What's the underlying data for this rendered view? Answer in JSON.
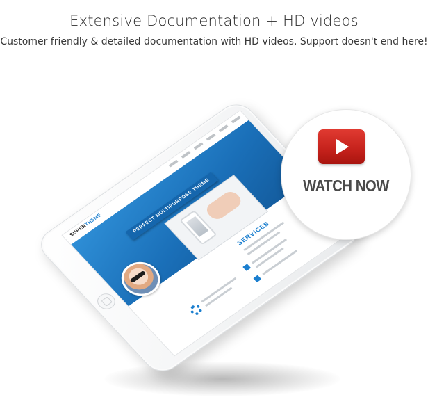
{
  "header": {
    "title": "Extensive Documentation + HD videos",
    "subtitle": "Customer friendly & detailed documentation with HD videos. Support doesn't end here!"
  },
  "tablet": {
    "site_logo_main": "SUPER",
    "site_logo_accent": "THEME",
    "hero_banner": "PERFECT MULTIPURPOSE THEME",
    "services_heading": "SERVICES"
  },
  "video_cta": {
    "label": "WATCH NOW",
    "icon": "play-icon",
    "button_color": "#cf2a22"
  },
  "colors": {
    "accent": "#1b7fcf",
    "text": "#2b2b2b"
  }
}
